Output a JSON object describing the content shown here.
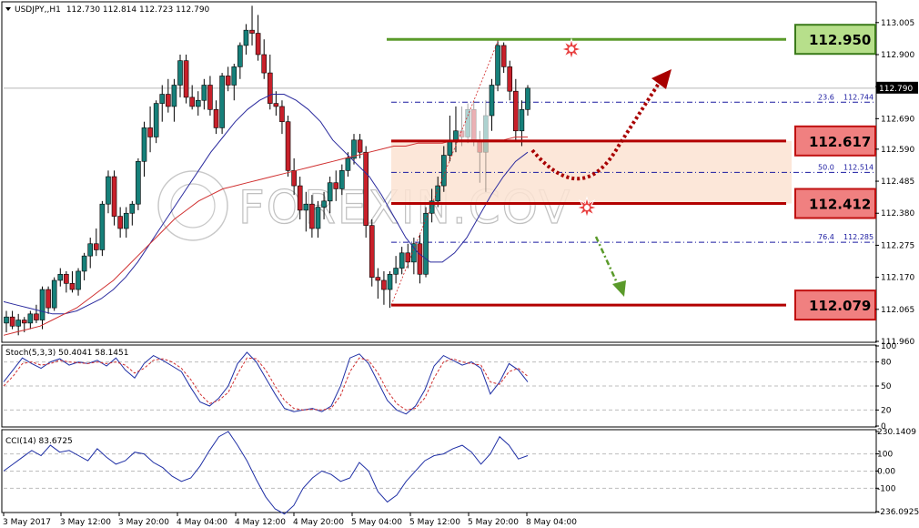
{
  "header": {
    "symbol": "USDJPY,,H1",
    "ohlc": "112.730 112.814 112.723 112.790"
  },
  "watermark": "FOREXIN.COV",
  "colors": {
    "bull": "#16807a",
    "bear": "#c8202a",
    "sma": "#2b2b9e",
    "sma_long": "#d03030",
    "resistance": "#b30000",
    "support_top": "#5a9a2a",
    "zone": "#fbe3d2",
    "arrow_up": "#a80000",
    "arrow_down": "#5a9a2a",
    "stoch_main": "#1f2fa5",
    "stoch_signal": "#d03030",
    "cci": "#1f2fa5"
  },
  "chart_data": [
    {
      "type": "candlestick",
      "title": "USDJPY,,H1 112.730 112.814 112.723 112.790",
      "current_price": "112.790",
      "ylim": [
        111.96,
        113.07
      ],
      "y_ticks": [
        "113.005",
        "112.900",
        "112.795",
        "112.690",
        "112.590",
        "112.485",
        "112.380",
        "112.275",
        "112.170",
        "112.065",
        "111.960"
      ],
      "x_ticks": [
        "3 May 2017",
        "3 May 12:00",
        "3 May 20:00",
        "4 May 04:00",
        "4 May 12:00",
        "4 May 20:00",
        "5 May 04:00",
        "5 May 12:00",
        "5 May 20:00",
        "8 May 04:00"
      ],
      "candles": [
        [
          112.02,
          112.06,
          111.99,
          112.04
        ],
        [
          112.04,
          112.06,
          112.0,
          112.01
        ],
        [
          112.01,
          112.05,
          111.98,
          112.03
        ],
        [
          112.03,
          112.04,
          111.99,
          112.02
        ],
        [
          112.02,
          112.06,
          112.0,
          112.05
        ],
        [
          112.05,
          112.08,
          112.02,
          112.03
        ],
        [
          112.03,
          112.14,
          112.0,
          112.13
        ],
        [
          112.13,
          112.14,
          112.05,
          112.07
        ],
        [
          112.07,
          112.17,
          112.06,
          112.16
        ],
        [
          112.16,
          112.2,
          112.14,
          112.18
        ],
        [
          112.18,
          112.19,
          112.12,
          112.15
        ],
        [
          112.15,
          112.19,
          112.12,
          112.13
        ],
        [
          112.13,
          112.2,
          112.11,
          112.19
        ],
        [
          112.19,
          112.25,
          112.16,
          112.24
        ],
        [
          112.24,
          112.3,
          112.2,
          112.28
        ],
        [
          112.28,
          112.33,
          112.24,
          112.26
        ],
        [
          112.26,
          112.42,
          112.24,
          112.41
        ],
        [
          112.41,
          112.52,
          112.38,
          112.5
        ],
        [
          112.5,
          112.52,
          112.34,
          112.37
        ],
        [
          112.37,
          112.4,
          112.3,
          112.33
        ],
        [
          112.33,
          112.4,
          112.3,
          112.38
        ],
        [
          112.38,
          112.42,
          112.34,
          112.41
        ],
        [
          112.41,
          112.56,
          112.39,
          112.55
        ],
        [
          112.55,
          112.68,
          112.5,
          112.66
        ],
        [
          112.66,
          112.73,
          112.58,
          112.63
        ],
        [
          112.63,
          112.75,
          112.61,
          112.74
        ],
        [
          112.74,
          112.8,
          112.68,
          112.77
        ],
        [
          112.77,
          112.82,
          112.71,
          112.73
        ],
        [
          112.73,
          112.82,
          112.68,
          112.8
        ],
        [
          112.8,
          112.9,
          112.76,
          112.88
        ],
        [
          112.88,
          112.9,
          112.74,
          112.76
        ],
        [
          112.76,
          112.8,
          112.72,
          112.73
        ],
        [
          112.73,
          112.78,
          112.7,
          112.75
        ],
        [
          112.75,
          112.82,
          112.72,
          112.8
        ],
        [
          112.8,
          112.83,
          112.7,
          112.72
        ],
        [
          112.72,
          112.75,
          112.64,
          112.66
        ],
        [
          112.66,
          112.84,
          112.64,
          112.83
        ],
        [
          112.83,
          112.86,
          112.78,
          112.8
        ],
        [
          112.8,
          112.87,
          112.75,
          112.86
        ],
        [
          112.86,
          112.94,
          112.82,
          112.93
        ],
        [
          112.93,
          113.0,
          112.9,
          112.98
        ],
        [
          112.98,
          113.06,
          112.93,
          112.97
        ],
        [
          112.97,
          113.03,
          112.88,
          112.9
        ],
        [
          112.9,
          112.95,
          112.82,
          112.84
        ],
        [
          112.84,
          112.9,
          112.72,
          112.74
        ],
        [
          112.74,
          112.78,
          112.7,
          112.73
        ],
        [
          112.73,
          112.75,
          112.64,
          112.68
        ],
        [
          112.68,
          112.7,
          112.5,
          112.52
        ],
        [
          112.52,
          112.56,
          112.44,
          112.47
        ],
        [
          112.47,
          112.5,
          112.36,
          112.39
        ],
        [
          112.39,
          112.45,
          112.32,
          112.41
        ],
        [
          112.41,
          112.44,
          112.3,
          112.33
        ],
        [
          112.33,
          112.42,
          112.3,
          112.4
        ],
        [
          112.4,
          112.45,
          112.36,
          112.42
        ],
        [
          112.42,
          112.5,
          112.38,
          112.48
        ],
        [
          112.48,
          112.52,
          112.42,
          112.46
        ],
        [
          112.46,
          112.54,
          112.44,
          112.52
        ],
        [
          112.52,
          112.58,
          112.5,
          112.56
        ],
        [
          112.56,
          112.64,
          112.54,
          112.62
        ],
        [
          112.62,
          112.64,
          112.56,
          112.58
        ],
        [
          112.58,
          112.6,
          112.3,
          112.34
        ],
        [
          112.34,
          112.36,
          112.14,
          112.17
        ],
        [
          112.17,
          112.2,
          112.1,
          112.16
        ],
        [
          112.16,
          112.19,
          112.08,
          112.13
        ],
        [
          112.13,
          112.19,
          112.07,
          112.18
        ],
        [
          112.18,
          112.24,
          112.15,
          112.2
        ],
        [
          112.2,
          112.27,
          112.18,
          112.25
        ],
        [
          112.25,
          112.28,
          112.2,
          112.22
        ],
        [
          112.22,
          112.3,
          112.18,
          112.28
        ],
        [
          112.28,
          112.31,
          112.15,
          112.18
        ],
        [
          112.18,
          112.4,
          112.17,
          112.38
        ],
        [
          112.38,
          112.46,
          112.35,
          112.42
        ],
        [
          112.42,
          112.5,
          112.4,
          112.47
        ],
        [
          112.47,
          112.6,
          112.45,
          112.57
        ],
        [
          112.57,
          112.7,
          112.55,
          112.62
        ],
        [
          112.62,
          112.73,
          112.58,
          112.65
        ],
        [
          112.65,
          112.73,
          112.6,
          112.63
        ],
        [
          112.63,
          112.74,
          112.61,
          112.72
        ],
        [
          112.72,
          112.75,
          112.6,
          112.62
        ],
        [
          112.62,
          112.65,
          112.48,
          112.58
        ],
        [
          112.58,
          112.75,
          112.45,
          112.7
        ],
        [
          112.7,
          112.82,
          112.65,
          112.8
        ],
        [
          112.8,
          112.95,
          112.78,
          112.93
        ],
        [
          112.93,
          112.94,
          112.84,
          112.86
        ],
        [
          112.86,
          112.88,
          112.75,
          112.78
        ],
        [
          112.78,
          112.82,
          112.62,
          112.65
        ],
        [
          112.65,
          112.75,
          112.6,
          112.72
        ],
        [
          112.72,
          112.8,
          112.7,
          112.79
        ]
      ],
      "sma_short": [
        112.09,
        112.08,
        112.07,
        112.06,
        112.05,
        112.05,
        112.06,
        112.08,
        112.1,
        112.13,
        112.17,
        112.22,
        112.28,
        112.34,
        112.4,
        112.46,
        112.52,
        112.58,
        112.63,
        112.68,
        112.72,
        112.75,
        112.77,
        112.77,
        112.75,
        112.72,
        112.68,
        112.62,
        112.58,
        112.54,
        112.5,
        112.44,
        112.37,
        112.3,
        112.25,
        112.22,
        112.22,
        112.25,
        112.3,
        112.37,
        112.44,
        112.5,
        112.55,
        112.58
      ],
      "sma_long": [
        111.98,
        111.99,
        112.0,
        112.01,
        112.03,
        112.05,
        112.07,
        112.1,
        112.13,
        112.16,
        112.2,
        112.24,
        112.28,
        112.32,
        112.36,
        112.39,
        112.42,
        112.44,
        112.46,
        112.47,
        112.48,
        112.49,
        112.5,
        112.51,
        112.52,
        112.53,
        112.54,
        112.55,
        112.56,
        112.57,
        112.58,
        112.59,
        112.6,
        112.6,
        112.61,
        112.61,
        112.61,
        112.62,
        112.62,
        112.62,
        112.62,
        112.62,
        112.63,
        112.63
      ],
      "levels": [
        {
          "label": "112.950",
          "value": 112.95,
          "kind": "resistance-green"
        },
        {
          "label": "112.617",
          "value": 112.617,
          "kind": "resistance"
        },
        {
          "label": "112.412",
          "value": 112.412,
          "kind": "support"
        },
        {
          "label": "112.079",
          "value": 112.079,
          "kind": "support"
        }
      ],
      "fibonacci": [
        {
          "ratio": "23.6",
          "value": "112.744"
        },
        {
          "ratio": "50.0",
          "value": "112.514"
        },
        {
          "ratio": "76.4",
          "value": "112.285"
        }
      ]
    },
    {
      "type": "line",
      "title": "Stoch(5,3,3) 50.4041 58.1451",
      "ylim": [
        0,
        100
      ],
      "y_ticks": [
        "100",
        "80",
        "50",
        "20",
        "0"
      ],
      "series": [
        {
          "values": [
            55,
            70,
            85,
            78,
            72,
            80,
            84,
            76,
            80,
            78,
            82,
            75,
            85,
            70,
            60,
            78,
            88,
            82,
            75,
            68,
            48,
            30,
            25,
            35,
            50,
            78,
            92,
            80,
            60,
            40,
            22,
            18,
            20,
            22,
            18,
            25,
            50,
            85,
            90,
            78,
            55,
            32,
            20,
            15,
            25,
            45,
            75,
            88,
            82,
            76,
            80,
            72,
            40,
            55,
            78,
            70,
            55
          ]
        },
        {
          "values": [
            50,
            62,
            78,
            80,
            76,
            78,
            82,
            80,
            79,
            78,
            80,
            78,
            80,
            76,
            66,
            72,
            82,
            84,
            80,
            72,
            58,
            40,
            28,
            32,
            42,
            65,
            85,
            84,
            70,
            50,
            32,
            22,
            20,
            21,
            20,
            22,
            38,
            68,
            85,
            82,
            66,
            44,
            28,
            20,
            22,
            35,
            60,
            80,
            84,
            80,
            78,
            76,
            55,
            52,
            68,
            72,
            62
          ]
        }
      ]
    },
    {
      "type": "line",
      "title": "CCI(14) 83.6725",
      "ylim": [
        -236.0925,
        230.1409
      ],
      "y_ticks": [
        "230.1409",
        "100",
        "0.00",
        "-100",
        "-236.0925"
      ],
      "series": [
        {
          "values": [
            0,
            40,
            80,
            120,
            90,
            150,
            110,
            120,
            90,
            60,
            130,
            80,
            40,
            60,
            110,
            100,
            50,
            20,
            -30,
            -60,
            -40,
            30,
            120,
            200,
            230,
            150,
            60,
            -50,
            -150,
            -220,
            -250,
            -200,
            -100,
            -40,
            0,
            -20,
            -60,
            -40,
            50,
            0,
            -120,
            -180,
            -140,
            -60,
            0,
            60,
            90,
            100,
            130,
            150,
            110,
            40,
            100,
            200,
            150,
            70,
            90
          ]
        }
      ]
    }
  ]
}
